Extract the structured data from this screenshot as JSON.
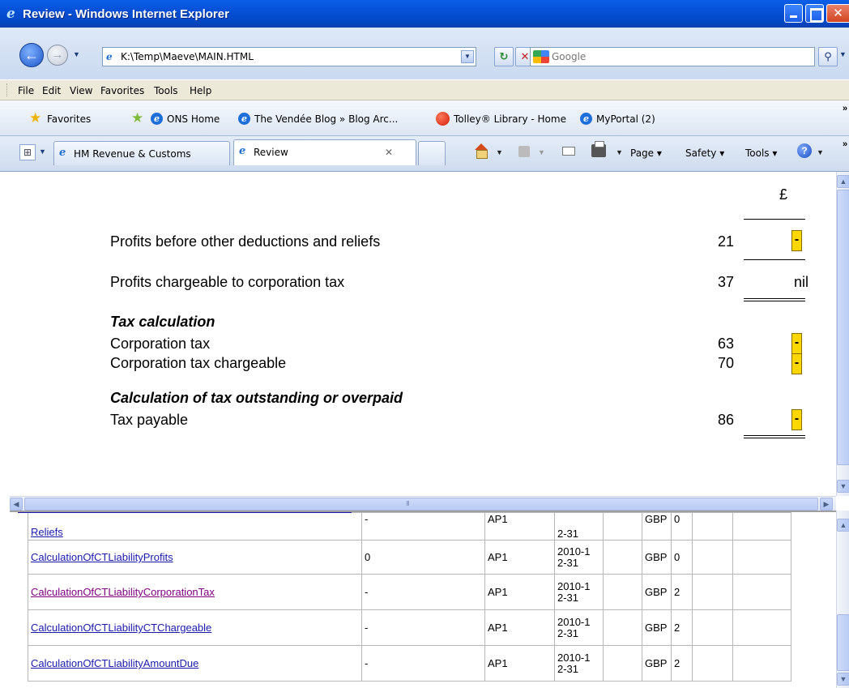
{
  "window": {
    "title": "Review - Windows Internet Explorer"
  },
  "address": {
    "url": "K:\\Temp\\Maeve\\MAIN.HTML",
    "search_placeholder": "Google"
  },
  "menu": {
    "items": [
      "File",
      "Edit",
      "View",
      "Favorites",
      "Tools",
      "Help"
    ]
  },
  "favorites": {
    "label": "Favorites",
    "links": [
      "ONS Home",
      "The Vendée Blog » Blog Arc...",
      "Tolley® Library - Home",
      "MyPortal (2)"
    ]
  },
  "tabs": {
    "items": [
      {
        "label": "HM Revenue & Customs",
        "active": false
      },
      {
        "label": "Review",
        "active": true
      }
    ],
    "commands": [
      "Page ▾",
      "Safety ▾",
      "Tools ▾"
    ]
  },
  "document": {
    "currency_header": "£",
    "rows": [
      {
        "label": "Profits before other deductions and reliefs",
        "ref": "21",
        "value": "-"
      },
      {
        "label": "Profits chargeable to corporation tax",
        "ref": "37",
        "value": "nil"
      },
      {
        "label": "Tax calculation",
        "heading": true
      },
      {
        "label": "Corporation tax",
        "ref": "63",
        "value": "-"
      },
      {
        "label": "Corporation tax chargeable",
        "ref": "70",
        "value": "-"
      },
      {
        "label": "Calculation of tax outstanding or overpaid",
        "heading": true
      },
      {
        "label": "Tax payable",
        "ref": "86",
        "value": "-"
      }
    ]
  },
  "table": {
    "rows": [
      {
        "name": "Reliefs",
        "value": "-",
        "period": "AP1",
        "date": [
          "",
          "2-31"
        ],
        "currency": "GBP",
        "decimals": "0"
      },
      {
        "name": "CalculationOfCTLiabilityProfits",
        "value": "0",
        "period": "AP1",
        "date": [
          "2010-1",
          "2-31"
        ],
        "currency": "GBP",
        "decimals": "0"
      },
      {
        "name": "CalculationOfCTLiabilityCorporationTax",
        "value": "-",
        "period": "AP1",
        "date": [
          "2010-1",
          "2-31"
        ],
        "currency": "GBP",
        "decimals": "2",
        "visited": true
      },
      {
        "name": "CalculationOfCTLiabilityCTChargeable",
        "value": "-",
        "period": "AP1",
        "date": [
          "2010-1",
          "2-31"
        ],
        "currency": "GBP",
        "decimals": "2"
      },
      {
        "name": "CalculationOfCTLiabilityAmountDue",
        "value": "-",
        "period": "AP1",
        "date": [
          "2010-1",
          "2-31"
        ],
        "currency": "GBP",
        "decimals": "2"
      }
    ]
  }
}
